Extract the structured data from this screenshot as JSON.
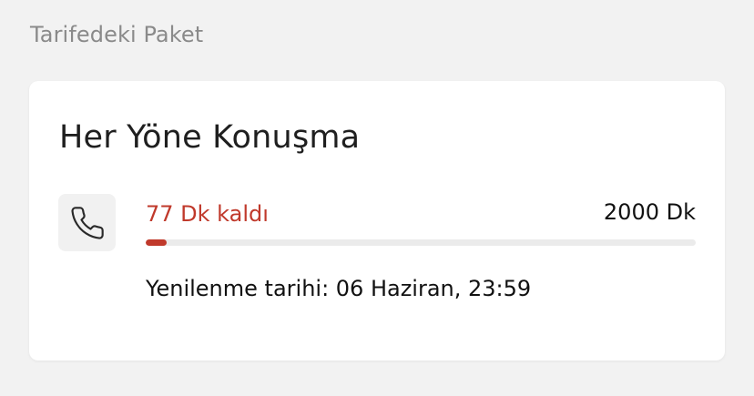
{
  "section": {
    "title": "Tarifedeki Paket"
  },
  "package": {
    "name": "Her Yöne Konuşma",
    "icon": "phone-icon",
    "remaining_label": "77 Dk kaldı",
    "total_label": "2000 Dk",
    "remaining_fraction": 0.0385,
    "renewal_text": "Yenilenme tarihi: 06 Haziran, 23:59"
  },
  "colors": {
    "accent": "#c0392b",
    "track": "#ebebeb",
    "card": "#ffffff",
    "background": "#f2f2f2"
  }
}
